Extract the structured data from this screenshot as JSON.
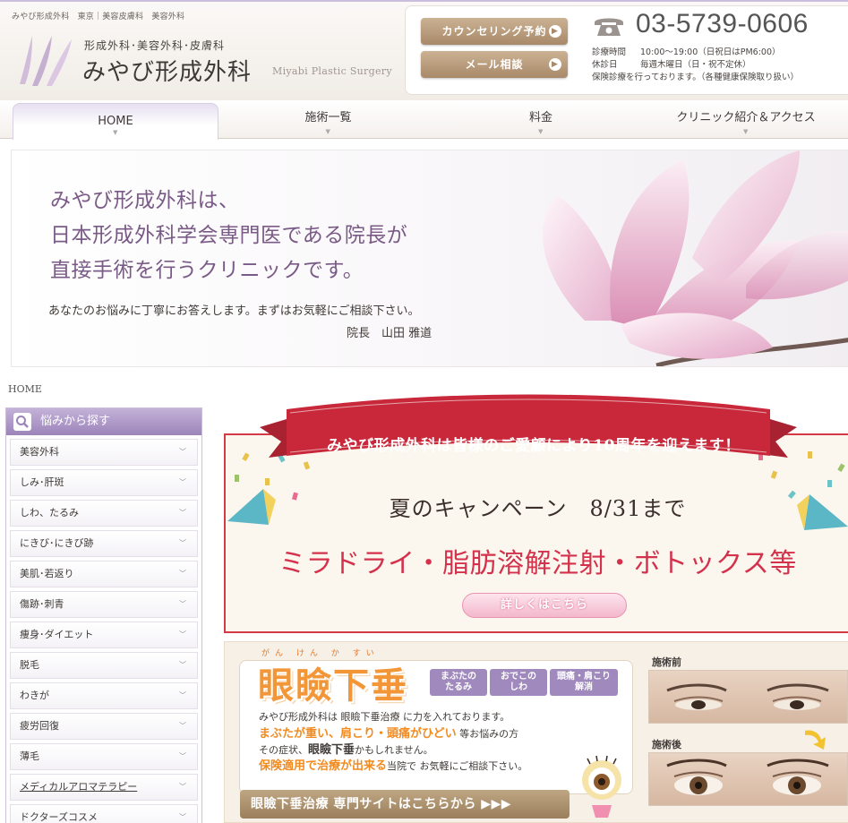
{
  "header": {
    "tagline": "みやび形成外科　東京｜美容皮膚科　美容外科",
    "logo_sub": "形成外科･美容外科･皮膚科",
    "logo_name": "みやび形成外科",
    "logo_en": "Miyabi Plastic Surgery",
    "counsel_button": "カウンセリング予約",
    "mail_button": "メール相談",
    "phone": "03-5739-0606",
    "hours_label": "診療時間",
    "hours_value": "10:00〜19:00（日祝日はPM6:00）",
    "closed_label": "休診日",
    "closed_value": "毎週木曜日（日・祝不定休）",
    "insurance": "保険診療を行っております。（各種健康保険取り扱い）"
  },
  "nav": {
    "home": "HOME",
    "procedures": "施術一覧",
    "price": "料金",
    "clinic": "クリニック紹介＆アクセス"
  },
  "hero": {
    "line1": "みやび形成外科は、",
    "line2": "日本形成外科学会専門医である院長が",
    "line3": "直接手術を行うクリニックです。",
    "sub": "あなたのお悩みに丁寧にお答えします。まずはお気軽にご相談下さい。",
    "sign": "院長　山田 雅道"
  },
  "breadcrumb": "HOME",
  "sidebar": {
    "heading": "悩みから探す",
    "items": [
      {
        "label": "美容外科"
      },
      {
        "label": "しみ･肝斑"
      },
      {
        "label": "しわ、たるみ"
      },
      {
        "label": "にきび･にきび跡"
      },
      {
        "label": "美肌･若返り"
      },
      {
        "label": "傷跡･刺青"
      },
      {
        "label": "痩身･ダイエット"
      },
      {
        "label": "脱毛"
      },
      {
        "label": "わきが"
      },
      {
        "label": "疲労回復"
      },
      {
        "label": "薄毛"
      },
      {
        "label": "メディカルアロマテラピー"
      },
      {
        "label": "ドクターズコスメ"
      }
    ]
  },
  "campaign": {
    "ribbon": "みやび形成外科は皆様のご愛顧により10周年を迎えます！",
    "title": "夏のキャンペーン　8/31まで",
    "items": "ミラドライ・脂肪溶解注射・ボトックス等",
    "details_button": "詳しくはこちら"
  },
  "ptosis": {
    "ruby": "がん けん か すい",
    "title": "眼瞼下垂",
    "tags": [
      {
        "l1": "まぶたの",
        "l2": "たるみ"
      },
      {
        "l1": "おでこの",
        "l2": "しわ"
      },
      {
        "l1": "頭痛・肩こり",
        "l2": "解消"
      }
    ],
    "text1": "みやび形成外科は 眼瞼下垂治療 に力を入れております。",
    "text2_highlight": "まぶたが重い、肩こり・頭痛がひどい",
    "text2_rest": " 等お悩みの方",
    "text3_a": "その症状、",
    "text3_bold": "眼瞼下垂",
    "text3_b": "かもしれません。",
    "text4_highlight": "保険適用で治療が出来る",
    "text4_rest": "当院で お気軽にご相談下さい。",
    "site_button": "眼瞼下垂治療 専門サイトはこちらから ▶▶▶",
    "before_label": "施術前",
    "after_label": "施術後"
  },
  "colors": {
    "accent_purple": "#9c84b9",
    "hero_text": "#7a5a86",
    "campaign_red": "#d4314c",
    "ptosis_orange": "#f29638",
    "button_brown": "#a88969"
  }
}
